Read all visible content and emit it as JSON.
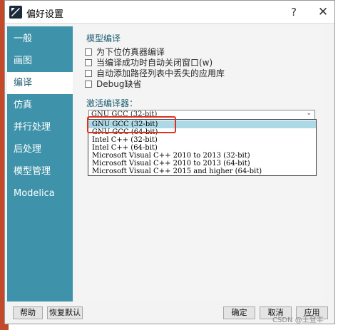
{
  "window": {
    "title": "偏好设置",
    "help_label": "?",
    "close_label": "✕"
  },
  "sidebar": {
    "items": [
      {
        "label": "一般"
      },
      {
        "label": "画图"
      },
      {
        "label": "编译"
      },
      {
        "label": "仿真"
      },
      {
        "label": "并行处理"
      },
      {
        "label": "后处理"
      },
      {
        "label": "模型管理"
      },
      {
        "label": "Modelica"
      }
    ],
    "active": "编译"
  },
  "model_compile": {
    "title": "模型编译",
    "options": [
      {
        "label": "为下位仿真器编译",
        "checked": false
      },
      {
        "label": "当编译成功时自动关闭窗口(w)",
        "checked": false
      },
      {
        "label": "自动添加路径列表中丢失的应用库",
        "checked": false
      },
      {
        "label": "Debug缺省",
        "checked": false
      }
    ]
  },
  "compiler": {
    "title": "激活编译器：",
    "selected": "GNU GCC (32-bit)",
    "options": [
      "GNU GCC (32-bit)",
      "GNU GCC (64-bit)",
      "Intel C++ (32-bit)",
      "Intel C++ (64-bit)",
      "Microsoft Visual C++ 2010 to 2013 (32-bit)",
      "Microsoft Visual C++ 2010 to 2013 (64-bit)",
      "Microsoft Visual C++ 2015 and higher (64-bit)"
    ],
    "highlighted_index": 0
  },
  "buttons": {
    "help": "帮助",
    "reset": "恢复默认",
    "ok": "确定",
    "cancel": "取消",
    "apply": "应用"
  },
  "watermark": "CSDN @王登丰",
  "colors": {
    "sidebar": "#3e92aa",
    "highlight": "#add8e6",
    "annotation": "#e03020"
  }
}
